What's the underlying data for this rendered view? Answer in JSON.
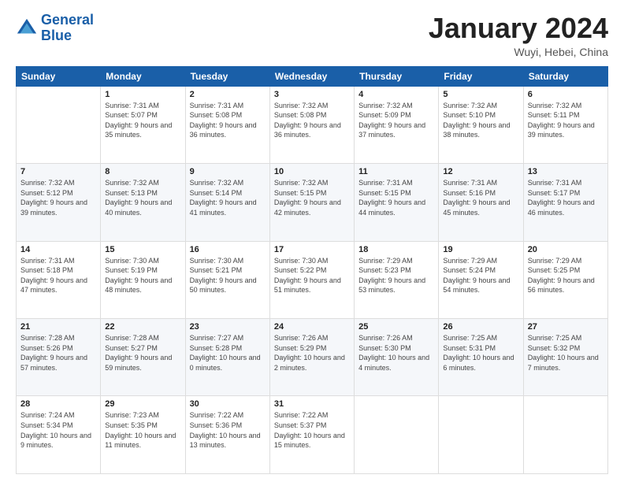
{
  "header": {
    "logo_line1": "General",
    "logo_line2": "Blue",
    "month_title": "January 2024",
    "location": "Wuyi, Hebei, China"
  },
  "days_of_week": [
    "Sunday",
    "Monday",
    "Tuesday",
    "Wednesday",
    "Thursday",
    "Friday",
    "Saturday"
  ],
  "weeks": [
    [
      {
        "day": "",
        "sunrise": "",
        "sunset": "",
        "daylight": ""
      },
      {
        "day": "1",
        "sunrise": "Sunrise: 7:31 AM",
        "sunset": "Sunset: 5:07 PM",
        "daylight": "Daylight: 9 hours and 35 minutes."
      },
      {
        "day": "2",
        "sunrise": "Sunrise: 7:31 AM",
        "sunset": "Sunset: 5:08 PM",
        "daylight": "Daylight: 9 hours and 36 minutes."
      },
      {
        "day": "3",
        "sunrise": "Sunrise: 7:32 AM",
        "sunset": "Sunset: 5:08 PM",
        "daylight": "Daylight: 9 hours and 36 minutes."
      },
      {
        "day": "4",
        "sunrise": "Sunrise: 7:32 AM",
        "sunset": "Sunset: 5:09 PM",
        "daylight": "Daylight: 9 hours and 37 minutes."
      },
      {
        "day": "5",
        "sunrise": "Sunrise: 7:32 AM",
        "sunset": "Sunset: 5:10 PM",
        "daylight": "Daylight: 9 hours and 38 minutes."
      },
      {
        "day": "6",
        "sunrise": "Sunrise: 7:32 AM",
        "sunset": "Sunset: 5:11 PM",
        "daylight": "Daylight: 9 hours and 39 minutes."
      }
    ],
    [
      {
        "day": "7",
        "sunrise": "Sunrise: 7:32 AM",
        "sunset": "Sunset: 5:12 PM",
        "daylight": "Daylight: 9 hours and 39 minutes."
      },
      {
        "day": "8",
        "sunrise": "Sunrise: 7:32 AM",
        "sunset": "Sunset: 5:13 PM",
        "daylight": "Daylight: 9 hours and 40 minutes."
      },
      {
        "day": "9",
        "sunrise": "Sunrise: 7:32 AM",
        "sunset": "Sunset: 5:14 PM",
        "daylight": "Daylight: 9 hours and 41 minutes."
      },
      {
        "day": "10",
        "sunrise": "Sunrise: 7:32 AM",
        "sunset": "Sunset: 5:15 PM",
        "daylight": "Daylight: 9 hours and 42 minutes."
      },
      {
        "day": "11",
        "sunrise": "Sunrise: 7:31 AM",
        "sunset": "Sunset: 5:15 PM",
        "daylight": "Daylight: 9 hours and 44 minutes."
      },
      {
        "day": "12",
        "sunrise": "Sunrise: 7:31 AM",
        "sunset": "Sunset: 5:16 PM",
        "daylight": "Daylight: 9 hours and 45 minutes."
      },
      {
        "day": "13",
        "sunrise": "Sunrise: 7:31 AM",
        "sunset": "Sunset: 5:17 PM",
        "daylight": "Daylight: 9 hours and 46 minutes."
      }
    ],
    [
      {
        "day": "14",
        "sunrise": "Sunrise: 7:31 AM",
        "sunset": "Sunset: 5:18 PM",
        "daylight": "Daylight: 9 hours and 47 minutes."
      },
      {
        "day": "15",
        "sunrise": "Sunrise: 7:30 AM",
        "sunset": "Sunset: 5:19 PM",
        "daylight": "Daylight: 9 hours and 48 minutes."
      },
      {
        "day": "16",
        "sunrise": "Sunrise: 7:30 AM",
        "sunset": "Sunset: 5:21 PM",
        "daylight": "Daylight: 9 hours and 50 minutes."
      },
      {
        "day": "17",
        "sunrise": "Sunrise: 7:30 AM",
        "sunset": "Sunset: 5:22 PM",
        "daylight": "Daylight: 9 hours and 51 minutes."
      },
      {
        "day": "18",
        "sunrise": "Sunrise: 7:29 AM",
        "sunset": "Sunset: 5:23 PM",
        "daylight": "Daylight: 9 hours and 53 minutes."
      },
      {
        "day": "19",
        "sunrise": "Sunrise: 7:29 AM",
        "sunset": "Sunset: 5:24 PM",
        "daylight": "Daylight: 9 hours and 54 minutes."
      },
      {
        "day": "20",
        "sunrise": "Sunrise: 7:29 AM",
        "sunset": "Sunset: 5:25 PM",
        "daylight": "Daylight: 9 hours and 56 minutes."
      }
    ],
    [
      {
        "day": "21",
        "sunrise": "Sunrise: 7:28 AM",
        "sunset": "Sunset: 5:26 PM",
        "daylight": "Daylight: 9 hours and 57 minutes."
      },
      {
        "day": "22",
        "sunrise": "Sunrise: 7:28 AM",
        "sunset": "Sunset: 5:27 PM",
        "daylight": "Daylight: 9 hours and 59 minutes."
      },
      {
        "day": "23",
        "sunrise": "Sunrise: 7:27 AM",
        "sunset": "Sunset: 5:28 PM",
        "daylight": "Daylight: 10 hours and 0 minutes."
      },
      {
        "day": "24",
        "sunrise": "Sunrise: 7:26 AM",
        "sunset": "Sunset: 5:29 PM",
        "daylight": "Daylight: 10 hours and 2 minutes."
      },
      {
        "day": "25",
        "sunrise": "Sunrise: 7:26 AM",
        "sunset": "Sunset: 5:30 PM",
        "daylight": "Daylight: 10 hours and 4 minutes."
      },
      {
        "day": "26",
        "sunrise": "Sunrise: 7:25 AM",
        "sunset": "Sunset: 5:31 PM",
        "daylight": "Daylight: 10 hours and 6 minutes."
      },
      {
        "day": "27",
        "sunrise": "Sunrise: 7:25 AM",
        "sunset": "Sunset: 5:32 PM",
        "daylight": "Daylight: 10 hours and 7 minutes."
      }
    ],
    [
      {
        "day": "28",
        "sunrise": "Sunrise: 7:24 AM",
        "sunset": "Sunset: 5:34 PM",
        "daylight": "Daylight: 10 hours and 9 minutes."
      },
      {
        "day": "29",
        "sunrise": "Sunrise: 7:23 AM",
        "sunset": "Sunset: 5:35 PM",
        "daylight": "Daylight: 10 hours and 11 minutes."
      },
      {
        "day": "30",
        "sunrise": "Sunrise: 7:22 AM",
        "sunset": "Sunset: 5:36 PM",
        "daylight": "Daylight: 10 hours and 13 minutes."
      },
      {
        "day": "31",
        "sunrise": "Sunrise: 7:22 AM",
        "sunset": "Sunset: 5:37 PM",
        "daylight": "Daylight: 10 hours and 15 minutes."
      },
      {
        "day": "",
        "sunrise": "",
        "sunset": "",
        "daylight": ""
      },
      {
        "day": "",
        "sunrise": "",
        "sunset": "",
        "daylight": ""
      },
      {
        "day": "",
        "sunrise": "",
        "sunset": "",
        "daylight": ""
      }
    ]
  ]
}
